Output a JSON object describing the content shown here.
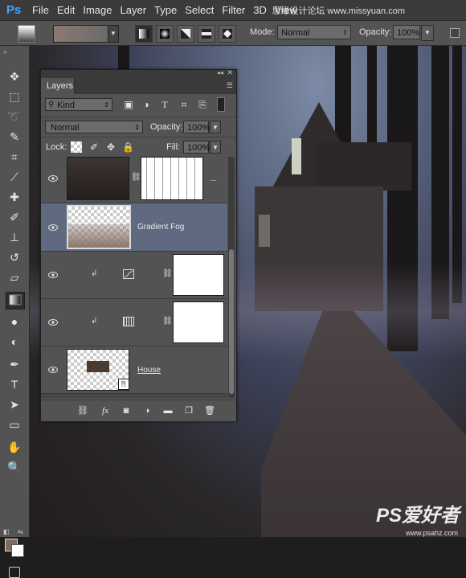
{
  "menubar": {
    "logo": "Ps",
    "items": [
      "File",
      "Edit",
      "Image",
      "Layer",
      "Type",
      "Select",
      "Filter",
      "3D",
      "View"
    ],
    "watermark": "思缘设计论坛 www.missyuan.com"
  },
  "options": {
    "mode_label": "Mode:",
    "mode_value": "Normal",
    "opacity_label": "Opacity:",
    "opacity_value": "100%"
  },
  "toolbar": {
    "tools": [
      "move",
      "marquee",
      "lasso",
      "quick-select",
      "crop",
      "eyedropper",
      "healing",
      "brush",
      "stamp",
      "history-brush",
      "eraser",
      "gradient",
      "blur",
      "dodge",
      "pen",
      "type",
      "path-select",
      "shape",
      "hand",
      "zoom"
    ],
    "active_tool": "gradient",
    "foreground_color": "#7d6b60",
    "background_color": "#ffffff"
  },
  "layers_panel": {
    "tab_label": "Layers",
    "filter_kind": "Kind",
    "blend_mode": "Normal",
    "opacity_label": "Opacity:",
    "opacity_value": "100%",
    "lock_label": "Lock:",
    "fill_label": "Fill:",
    "fill_value": "100%",
    "layers": [
      {
        "name": "",
        "kind": "image-with-mask",
        "suffix": "..."
      },
      {
        "name": "Gradient Fog",
        "kind": "gradient",
        "selected": true
      },
      {
        "name": "",
        "kind": "curves-adjustment",
        "clipped": true
      },
      {
        "name": "",
        "kind": "levels-adjustment",
        "clipped": true
      },
      {
        "name": "House",
        "kind": "smart-object"
      }
    ]
  },
  "watermark_bottom": {
    "brand": "PS爱好者",
    "url": "www.psahz.com"
  }
}
